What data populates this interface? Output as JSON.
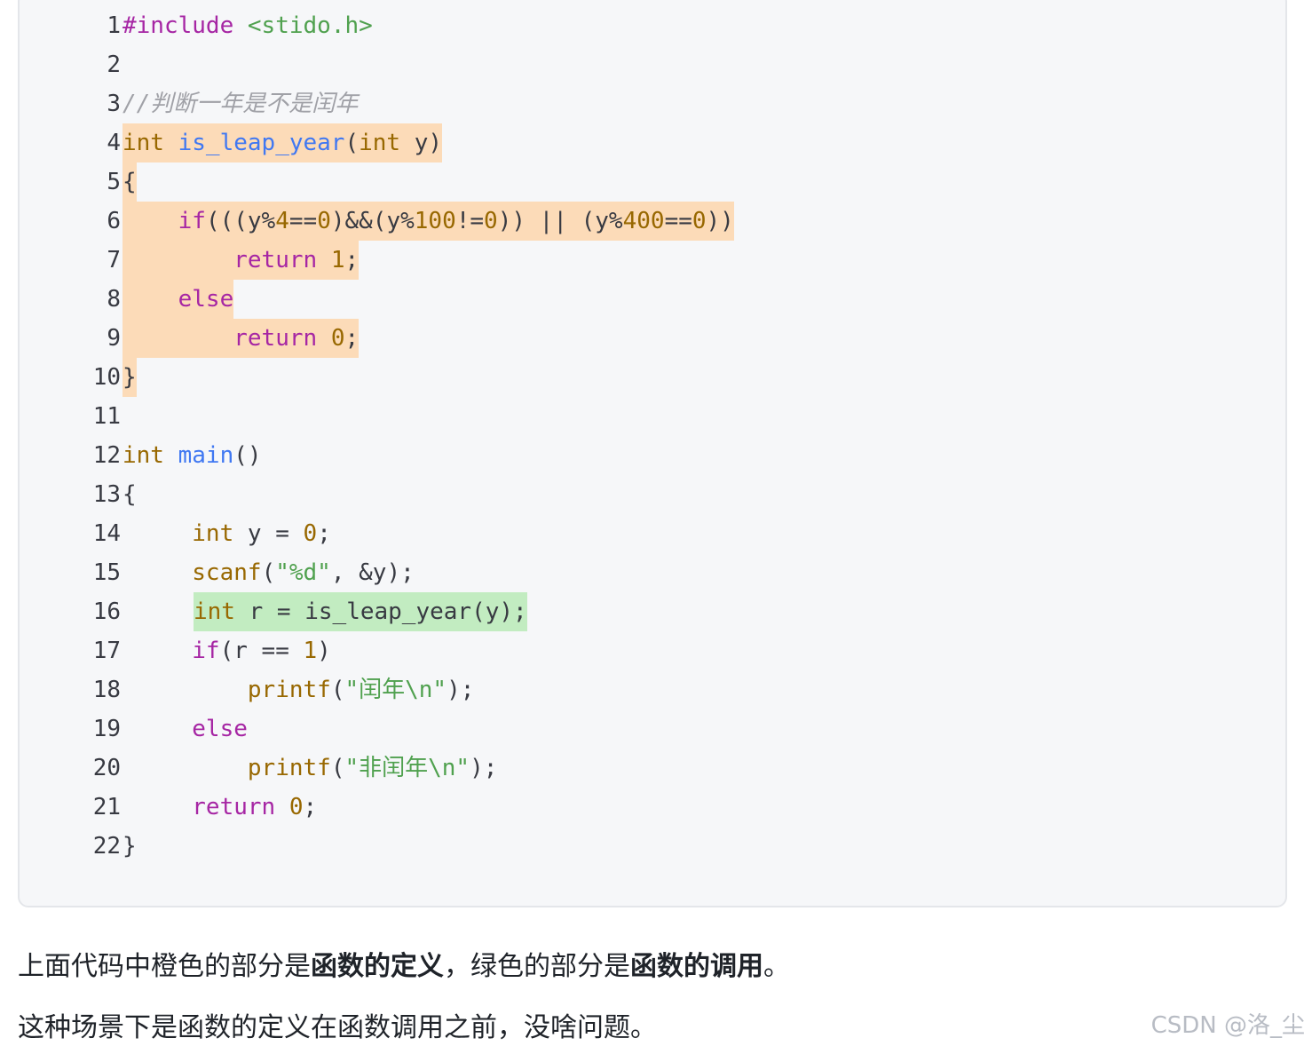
{
  "code": {
    "lines": [
      {
        "number": "1",
        "highlight": "",
        "tokens": [
          {
            "text": "#include",
            "kind": "keyword"
          },
          {
            "text": " ",
            "kind": "plain"
          },
          {
            "text": "<stido.h>",
            "kind": "string"
          }
        ]
      },
      {
        "number": "2",
        "highlight": "",
        "tokens": []
      },
      {
        "number": "3",
        "highlight": "",
        "tokens": [
          {
            "text": "//判断一年是不是闰年",
            "kind": "comment"
          }
        ]
      },
      {
        "number": "4",
        "highlight": "orange",
        "tokens": [
          {
            "text": "int",
            "kind": "type"
          },
          {
            "text": " ",
            "kind": "plain"
          },
          {
            "text": "is_leap_year",
            "kind": "function"
          },
          {
            "text": "(",
            "kind": "plain"
          },
          {
            "text": "int",
            "kind": "type"
          },
          {
            "text": " y)",
            "kind": "plain"
          }
        ]
      },
      {
        "number": "5",
        "highlight": "orange",
        "tokens": [
          {
            "text": "{",
            "kind": "plain"
          }
        ]
      },
      {
        "number": "6",
        "highlight": "orange",
        "tokens": [
          {
            "text": "    ",
            "kind": "plain"
          },
          {
            "text": "if",
            "kind": "keyword"
          },
          {
            "text": "(((y%",
            "kind": "plain"
          },
          {
            "text": "4",
            "kind": "number"
          },
          {
            "text": "==",
            "kind": "plain"
          },
          {
            "text": "0",
            "kind": "number"
          },
          {
            "text": ")&&(y%",
            "kind": "plain"
          },
          {
            "text": "100",
            "kind": "number"
          },
          {
            "text": "!=",
            "kind": "plain"
          },
          {
            "text": "0",
            "kind": "number"
          },
          {
            "text": ")) || (y%",
            "kind": "plain"
          },
          {
            "text": "400",
            "kind": "number"
          },
          {
            "text": "==",
            "kind": "plain"
          },
          {
            "text": "0",
            "kind": "number"
          },
          {
            "text": "))",
            "kind": "plain"
          }
        ]
      },
      {
        "number": "7",
        "highlight": "orange",
        "tokens": [
          {
            "text": "        ",
            "kind": "plain"
          },
          {
            "text": "return",
            "kind": "keyword"
          },
          {
            "text": " ",
            "kind": "plain"
          },
          {
            "text": "1",
            "kind": "number"
          },
          {
            "text": ";",
            "kind": "plain"
          }
        ]
      },
      {
        "number": "8",
        "highlight": "orange",
        "tokens": [
          {
            "text": "    ",
            "kind": "plain"
          },
          {
            "text": "else",
            "kind": "keyword"
          }
        ]
      },
      {
        "number": "9",
        "highlight": "orange",
        "tokens": [
          {
            "text": "        ",
            "kind": "plain"
          },
          {
            "text": "return",
            "kind": "keyword"
          },
          {
            "text": " ",
            "kind": "plain"
          },
          {
            "text": "0",
            "kind": "number"
          },
          {
            "text": ";",
            "kind": "plain"
          }
        ]
      },
      {
        "number": "10",
        "highlight": "orange",
        "tokens": [
          {
            "text": "}",
            "kind": "plain"
          }
        ]
      },
      {
        "number": "11",
        "highlight": "",
        "tokens": []
      },
      {
        "number": "12",
        "highlight": "",
        "tokens": [
          {
            "text": "int",
            "kind": "type"
          },
          {
            "text": " ",
            "kind": "plain"
          },
          {
            "text": "main",
            "kind": "function"
          },
          {
            "text": "()",
            "kind": "plain"
          }
        ]
      },
      {
        "number": "13",
        "highlight": "",
        "tokens": [
          {
            "text": "{",
            "kind": "plain"
          }
        ]
      },
      {
        "number": "14",
        "highlight": "",
        "tokens": [
          {
            "text": "     ",
            "kind": "plain"
          },
          {
            "text": "int",
            "kind": "type"
          },
          {
            "text": " y = ",
            "kind": "plain"
          },
          {
            "text": "0",
            "kind": "number"
          },
          {
            "text": ";",
            "kind": "plain"
          }
        ]
      },
      {
        "number": "15",
        "highlight": "",
        "tokens": [
          {
            "text": "     ",
            "kind": "plain"
          },
          {
            "text": "scanf",
            "kind": "call"
          },
          {
            "text": "(",
            "kind": "plain"
          },
          {
            "text": "\"%d\"",
            "kind": "string"
          },
          {
            "text": ", &y);",
            "kind": "plain"
          }
        ]
      },
      {
        "number": "16",
        "highlight": "green",
        "tokens": [
          {
            "text": "int",
            "kind": "type"
          },
          {
            "text": " r = is_leap_year(y);",
            "kind": "plain"
          }
        ]
      },
      {
        "number": "17",
        "highlight": "",
        "tokens": [
          {
            "text": "     ",
            "kind": "plain"
          },
          {
            "text": "if",
            "kind": "keyword"
          },
          {
            "text": "(r == ",
            "kind": "plain"
          },
          {
            "text": "1",
            "kind": "number"
          },
          {
            "text": ")",
            "kind": "plain"
          }
        ]
      },
      {
        "number": "18",
        "highlight": "",
        "tokens": [
          {
            "text": "         ",
            "kind": "plain"
          },
          {
            "text": "printf",
            "kind": "call"
          },
          {
            "text": "(",
            "kind": "plain"
          },
          {
            "text": "\"闰年\\n\"",
            "kind": "string"
          },
          {
            "text": ");",
            "kind": "plain"
          }
        ]
      },
      {
        "number": "19",
        "highlight": "",
        "tokens": [
          {
            "text": "     ",
            "kind": "plain"
          },
          {
            "text": "else",
            "kind": "keyword"
          }
        ]
      },
      {
        "number": "20",
        "highlight": "",
        "tokens": [
          {
            "text": "         ",
            "kind": "plain"
          },
          {
            "text": "printf",
            "kind": "call"
          },
          {
            "text": "(",
            "kind": "plain"
          },
          {
            "text": "\"非闰年\\n\"",
            "kind": "string"
          },
          {
            "text": ");",
            "kind": "plain"
          }
        ]
      },
      {
        "number": "21",
        "highlight": "",
        "tokens": [
          {
            "text": "     ",
            "kind": "plain"
          },
          {
            "text": "return",
            "kind": "keyword"
          },
          {
            "text": " ",
            "kind": "plain"
          },
          {
            "text": "0",
            "kind": "number"
          },
          {
            "text": ";",
            "kind": "plain"
          }
        ]
      },
      {
        "number": "22",
        "highlight": "",
        "tokens": [
          {
            "text": "}",
            "kind": "plain"
          }
        ]
      }
    ]
  },
  "paragraph1": {
    "part1": "上面代码中橙色的部分是",
    "bold1": "函数的定义",
    "part2": "，绿色的部分是",
    "bold2": "函数的调用",
    "part3": "。"
  },
  "paragraph2": {
    "text": "这种场景下是函数的定义在函数调用之前，没啥问题。"
  },
  "watermark": {
    "text": "CSDN @洛_尘"
  },
  "colors": {
    "orange_highlight": "#fcdbb8",
    "green_highlight": "#c2ecc1",
    "keyword": "#a626a4",
    "type": "#986801",
    "function": "#4078f2",
    "string": "#50a14f",
    "comment": "#a0a1a7"
  }
}
